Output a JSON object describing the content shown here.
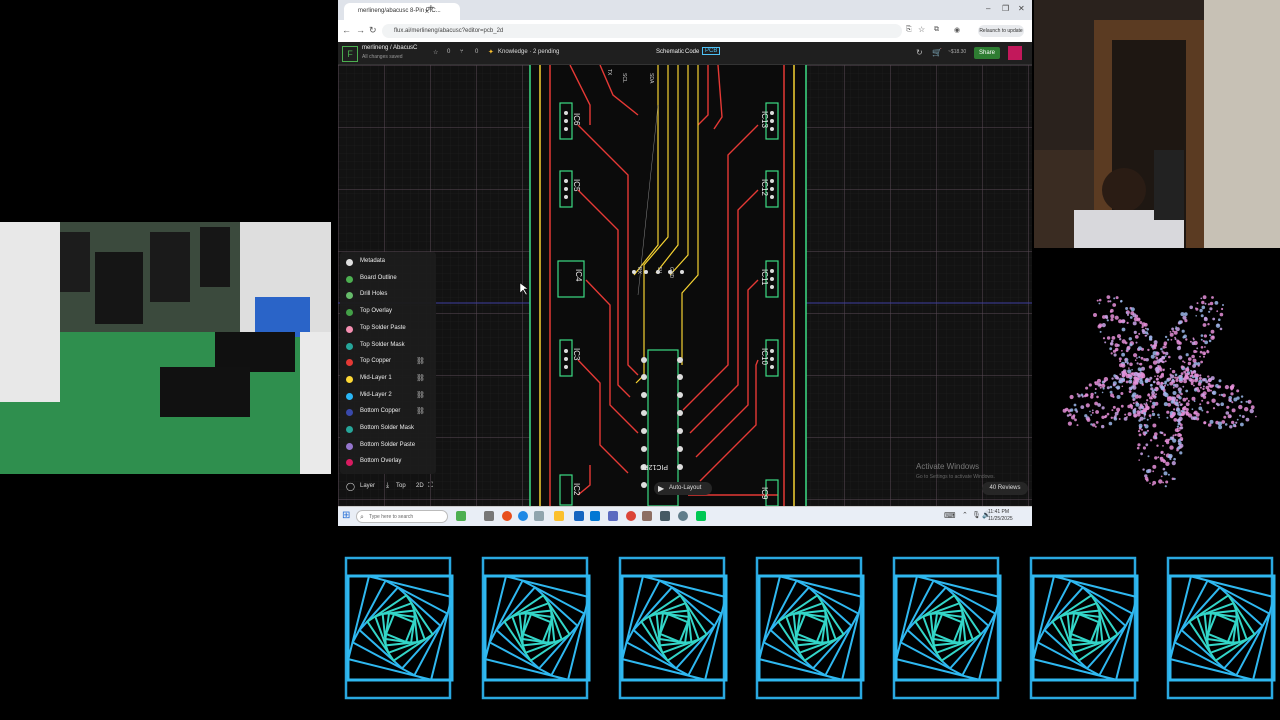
{
  "browser": {
    "tab_title": "merlineng/abacusc 8-Pin PIC...",
    "tab_close": "×",
    "new_tab": "+",
    "url": "flux.ai/merlineng/abacusc?editor=pcb_2d",
    "relaunch": "Relaunch to update",
    "window_controls": [
      "–",
      "❐",
      "✕"
    ],
    "nav": [
      "←",
      "→",
      "↻"
    ]
  },
  "app": {
    "project": "merlineng / AbacusC",
    "saved_status": "All changes saved",
    "stars": "0",
    "forks": "0",
    "knowledge": "Knowledge · 2 pending",
    "tabs": [
      "Schematic",
      "Code",
      "PCB"
    ],
    "credit": "~$18.30",
    "share": "Share"
  },
  "pcb": {
    "ic_labels": [
      "IC6",
      "IC5",
      "IC4",
      "IC3",
      "IC2",
      "IC13",
      "IC12",
      "IC11",
      "IC10",
      "IC9"
    ],
    "chip_label": "PIC12F0",
    "pin_labels": [
      "SCL",
      "SDA",
      "5V",
      "GND",
      "RX",
      "TX"
    ]
  },
  "layers": [
    {
      "name": "Metadata",
      "color": "#e0e0e0",
      "lock": false
    },
    {
      "name": "Board Outline",
      "color": "#4caf50",
      "lock": false
    },
    {
      "name": "Drill Holes",
      "color": "#66bb6a",
      "lock": false
    },
    {
      "name": "Top Overlay",
      "color": "#43a047",
      "lock": false
    },
    {
      "name": "Top Solder Paste",
      "color": "#f48fb1",
      "lock": false
    },
    {
      "name": "Top Solder Mask",
      "color": "#26a69a",
      "lock": false
    },
    {
      "name": "Top Copper",
      "color": "#e53935",
      "lock": true
    },
    {
      "name": "Mid-Layer 1",
      "color": "#fdd835",
      "lock": true
    },
    {
      "name": "Mid-Layer 2",
      "color": "#29b6f6",
      "lock": true
    },
    {
      "name": "Bottom Copper",
      "color": "#3949ab",
      "lock": true
    },
    {
      "name": "Bottom Solder Mask",
      "color": "#26a69a",
      "lock": false
    },
    {
      "name": "Bottom Solder Paste",
      "color": "#9575cd",
      "lock": false
    },
    {
      "name": "Bottom Overlay",
      "color": "#d81b60",
      "lock": false
    }
  ],
  "layer_bar": {
    "layer": "Layer",
    "side": "Top",
    "mode": "2D"
  },
  "auto_layout": "Auto-Layout",
  "reviews": "40 Reviews",
  "watermark": {
    "line1": "Activate Windows",
    "line2": "Go to Settings to activate Windows."
  },
  "taskbar": {
    "search_placeholder": "Type here to search",
    "time": "11:41 PM",
    "date": "11/25/2025"
  }
}
